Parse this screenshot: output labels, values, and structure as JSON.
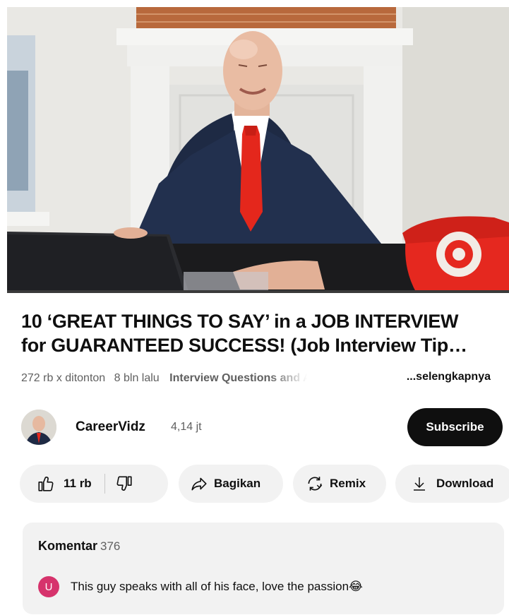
{
  "video": {
    "title_line1": "10 ‘GREAT THINGS TO SAY’ in a JOB INTERVIEW",
    "title_line2": "for GUARANTEED SUCCESS! (Job Interview Tip…",
    "views": "272 rb x ditonton",
    "age": "8 bln lalu",
    "tags": "Interview Questions and A",
    "more": "...selengkapnya"
  },
  "channel": {
    "name": "CareerVidz",
    "subscribers": "4,14 jt",
    "subscribe_label": "Subscribe"
  },
  "actions": {
    "likes": "11 rb",
    "share_label": "Bagikan",
    "remix_label": "Remix",
    "download_label": "Download"
  },
  "comments": {
    "heading": "Komentar",
    "count": "376",
    "top_comment": {
      "avatar_letter": "U",
      "avatar_color": "#d6336c",
      "text": "This guy speaks with all of his face, love the passion😂"
    }
  },
  "colors": {
    "subscribe_bg": "#0f0f0f",
    "chip_bg": "#f2f2f2",
    "tie": "#e4271c",
    "phone": "#e5281f"
  },
  "icons": [
    "thumbs-up-icon",
    "thumbs-down-icon",
    "share-arrow-icon",
    "remix-icon",
    "download-icon"
  ]
}
